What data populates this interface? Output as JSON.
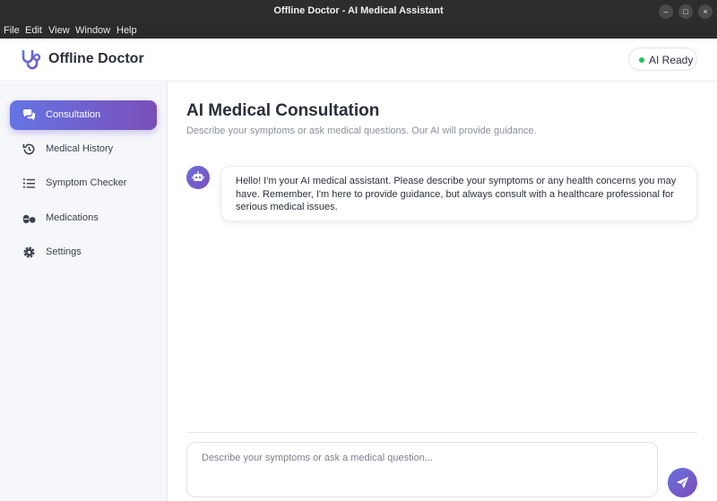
{
  "window": {
    "title": "Offline Doctor - AI Medical Assistant",
    "controls": {
      "minimize": "–",
      "maximize": "□",
      "close": "×"
    }
  },
  "menu": [
    "File",
    "Edit",
    "View",
    "Window",
    "Help"
  ],
  "header": {
    "app_name": "Offline Doctor",
    "logo_icon": "stethoscope-icon",
    "status_label": "AI Ready",
    "status_color": "#22c55e"
  },
  "sidebar": {
    "items": [
      {
        "label": "Consultation",
        "icon": "comments-icon",
        "active": true
      },
      {
        "label": "Medical History",
        "icon": "history-icon",
        "active": false
      },
      {
        "label": "Symptom Checker",
        "icon": "list-icon",
        "active": false
      },
      {
        "label": "Medications",
        "icon": "pills-icon",
        "active": false
      },
      {
        "label": "Settings",
        "icon": "gear-icon",
        "active": false
      }
    ]
  },
  "main": {
    "title": "AI Medical Consultation",
    "subtitle": "Describe your symptoms or ask medical questions. Our AI will provide guidance.",
    "messages": [
      {
        "sender": "ai",
        "avatar_icon": "robot-icon",
        "text": "Hello! I'm your AI medical assistant. Please describe your symptoms or any health concerns you may have. Remember, I'm here to provide guidance, but always consult with a healthcare professional for serious medical issues."
      }
    ],
    "input": {
      "placeholder": "Describe your symptoms or ask a medical question...",
      "value": ""
    },
    "send_icon": "paper-plane-icon"
  },
  "colors": {
    "accent_start": "#6574e4",
    "accent_end": "#7a4fb8"
  }
}
